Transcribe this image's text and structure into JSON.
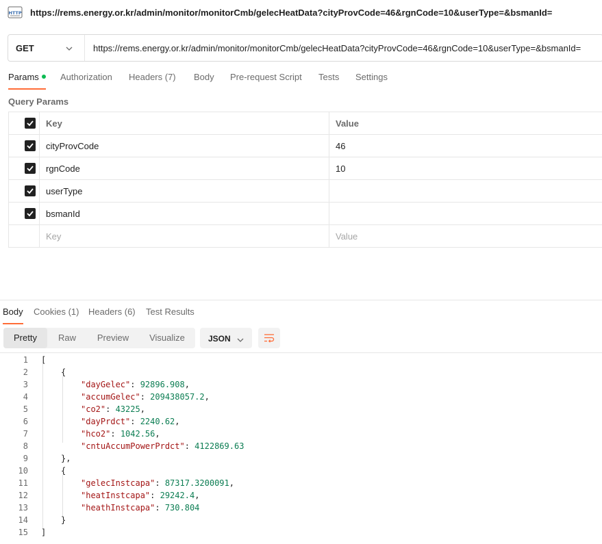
{
  "window": {
    "title_url": "https://rems.energy.or.kr/admin/monitor/monitorCmb/gelecHeatData?cityProvCode=46&rgnCode=10&userType=&bsmanId="
  },
  "request": {
    "method": "GET",
    "url": "https://rems.energy.or.kr/admin/monitor/monitorCmb/gelecHeatData?cityProvCode=46&rgnCode=10&userType=&bsmanId="
  },
  "request_tabs": [
    "Params",
    "Authorization",
    "Headers (7)",
    "Body",
    "Pre-request Script",
    "Tests",
    "Settings"
  ],
  "query_params": {
    "label": "Query Params",
    "header": {
      "key": "Key",
      "value": "Value"
    },
    "rows": [
      {
        "key": "cityProvCode",
        "value": "46",
        "checked": true
      },
      {
        "key": "rgnCode",
        "value": "10",
        "checked": true
      },
      {
        "key": "userType",
        "value": "",
        "checked": true
      },
      {
        "key": "bsmanId",
        "value": "",
        "checked": true
      }
    ],
    "placeholder": {
      "key": "Key",
      "value": "Value"
    }
  },
  "response_tabs": [
    "Body",
    "Cookies (1)",
    "Headers (6)",
    "Test Results"
  ],
  "view_modes": [
    "Pretty",
    "Raw",
    "Preview",
    "Visualize"
  ],
  "format": "JSON",
  "code_lines": [
    {
      "n": "1",
      "indent": 0,
      "text": "["
    },
    {
      "n": "2",
      "indent": 1,
      "text": "{"
    },
    {
      "n": "3",
      "indent": 2,
      "key": "dayGelec",
      "value": "92896.908",
      "comma": true
    },
    {
      "n": "4",
      "indent": 2,
      "key": "accumGelec",
      "value": "209438057.2",
      "comma": true
    },
    {
      "n": "5",
      "indent": 2,
      "key": "co2",
      "value": "43225",
      "comma": true
    },
    {
      "n": "6",
      "indent": 2,
      "key": "dayPrdct",
      "value": "2240.62",
      "comma": true
    },
    {
      "n": "7",
      "indent": 2,
      "key": "hco2",
      "value": "1042.56",
      "comma": true
    },
    {
      "n": "8",
      "indent": 2,
      "key": "cntuAccumPowerPrdct",
      "value": "4122869.63",
      "comma": false
    },
    {
      "n": "9",
      "indent": 1,
      "text": "},"
    },
    {
      "n": "10",
      "indent": 1,
      "text": "{"
    },
    {
      "n": "11",
      "indent": 2,
      "key": "gelecInstcapa",
      "value": "87317.3200091",
      "comma": true
    },
    {
      "n": "12",
      "indent": 2,
      "key": "heatInstcapa",
      "value": "29242.4",
      "comma": true
    },
    {
      "n": "13",
      "indent": 2,
      "key": "heathInstcapa",
      "value": "730.804",
      "comma": false
    },
    {
      "n": "14",
      "indent": 1,
      "text": "}"
    },
    {
      "n": "15",
      "indent": 0,
      "text": "]"
    }
  ],
  "colors": {
    "accent_tab": "#ff6c37",
    "params_dot": "#0cbb52",
    "json_key": "#a31515",
    "json_number": "#0b7d52"
  }
}
